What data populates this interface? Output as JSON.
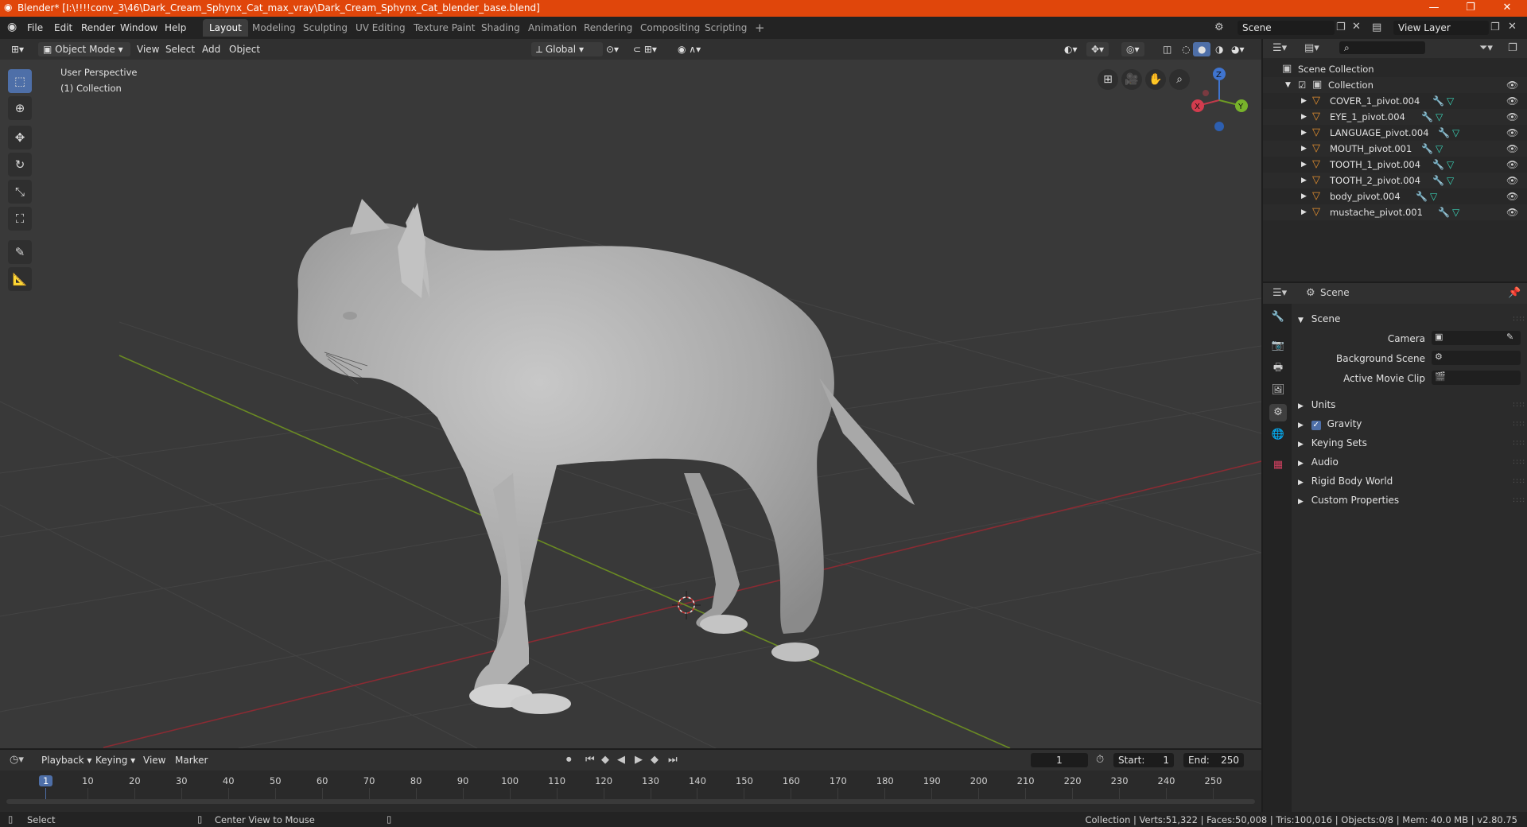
{
  "window": {
    "title": "Blender* [I:\\!!!!conv_3\\46\\Dark_Cream_Sphynx_Cat_max_vray\\Dark_Cream_Sphynx_Cat_blender_base.blend]",
    "controls": [
      "—",
      "❐",
      "✕"
    ]
  },
  "menu": [
    "File",
    "Edit",
    "Render",
    "Window",
    "Help"
  ],
  "workspaces": [
    "Layout",
    "Modeling",
    "Sculpting",
    "UV Editing",
    "Texture Paint",
    "Shading",
    "Animation",
    "Rendering",
    "Compositing",
    "Scripting"
  ],
  "workspace_add": "+",
  "scene_field": "Scene",
  "view_layer_field": "View Layer",
  "viewport_header": {
    "mode": "Object Mode",
    "menus": [
      "View",
      "Select",
      "Add",
      "Object"
    ],
    "orientation": "Global"
  },
  "viewport": {
    "perspective": "User Perspective",
    "collection": "(1) Collection",
    "gizmo": {
      "z": "Z",
      "x": "X",
      "y": "Y"
    }
  },
  "outliner": {
    "scene_collection": "Scene Collection",
    "collection": "Collection",
    "objects": [
      "COVER_1_pivot.004",
      "EYE_1_pivot.004",
      "LANGUAGE_pivot.004",
      "MOUTH_pivot.001",
      "TOOTH_1_pivot.004",
      "TOOTH_2_pivot.004",
      "body_pivot.004",
      "mustache_pivot.001"
    ]
  },
  "properties": {
    "context": "Scene",
    "panel": "Scene",
    "camera_label": "Camera",
    "background_scene_label": "Background Scene",
    "active_movie_clip_label": "Active Movie Clip",
    "subpanels": [
      "Units",
      "Gravity",
      "Keying Sets",
      "Audio",
      "Rigid Body World",
      "Custom Properties"
    ],
    "gravity_checked": true
  },
  "timeline": {
    "menus": [
      "Playback",
      "Keying",
      "View",
      "Marker"
    ],
    "current_frame": "1",
    "start_label": "Start:",
    "start": "1",
    "end_label": "End:",
    "end": "250",
    "ruler": [
      "1",
      "10",
      "20",
      "30",
      "40",
      "50",
      "60",
      "70",
      "80",
      "90",
      "100",
      "110",
      "120",
      "130",
      "140",
      "150",
      "160",
      "170",
      "180",
      "190",
      "200",
      "210",
      "220",
      "230",
      "240",
      "250"
    ]
  },
  "status": {
    "left": "Select",
    "middle": "Center View to Mouse",
    "right": "Collection | Verts:51,322 | Faces:50,008 | Tris:100,016 | Objects:0/8 | Mem: 40.0 MB | v2.80.75"
  }
}
